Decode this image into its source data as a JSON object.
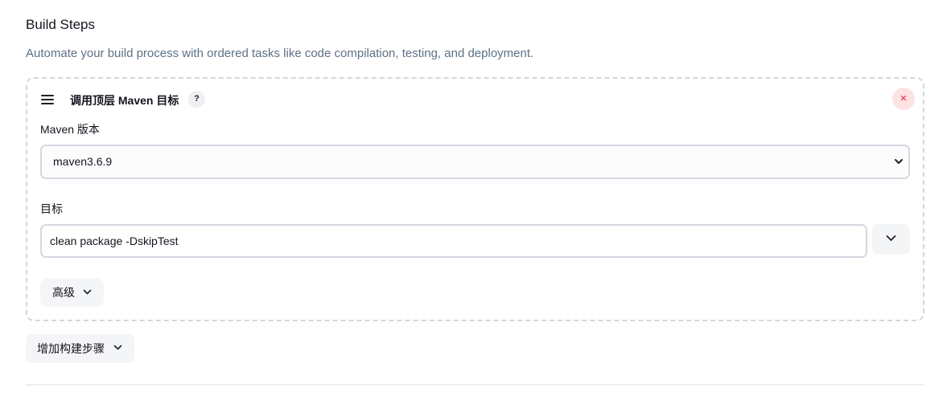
{
  "section": {
    "title": "Build Steps",
    "description": "Automate your build process with ordered tasks like code compilation, testing, and deployment."
  },
  "step": {
    "title": "调用顶层 Maven 目标",
    "help_label": "?",
    "close_label": "×",
    "maven_version_label": "Maven 版本",
    "maven_version_value": "maven3.6.9",
    "goals_label": "目标",
    "goals_value": "clean package -DskipTest",
    "advanced_label": "高级"
  },
  "footer": {
    "add_step_label": "增加构建步骤"
  },
  "colors": {
    "description": "#5c7185",
    "close_bg": "#fde2e4",
    "close_fg": "#e0253a",
    "button_bg": "#f4f5f7",
    "border": "#d6d8e0"
  },
  "icons": {
    "drag": "drag-handle-icon",
    "help": "help-icon",
    "close": "close-icon",
    "select": "chevron-down-icon",
    "expand": "chevron-down-icon",
    "advanced": "chevron-down-icon",
    "add_step": "chevron-down-icon"
  }
}
